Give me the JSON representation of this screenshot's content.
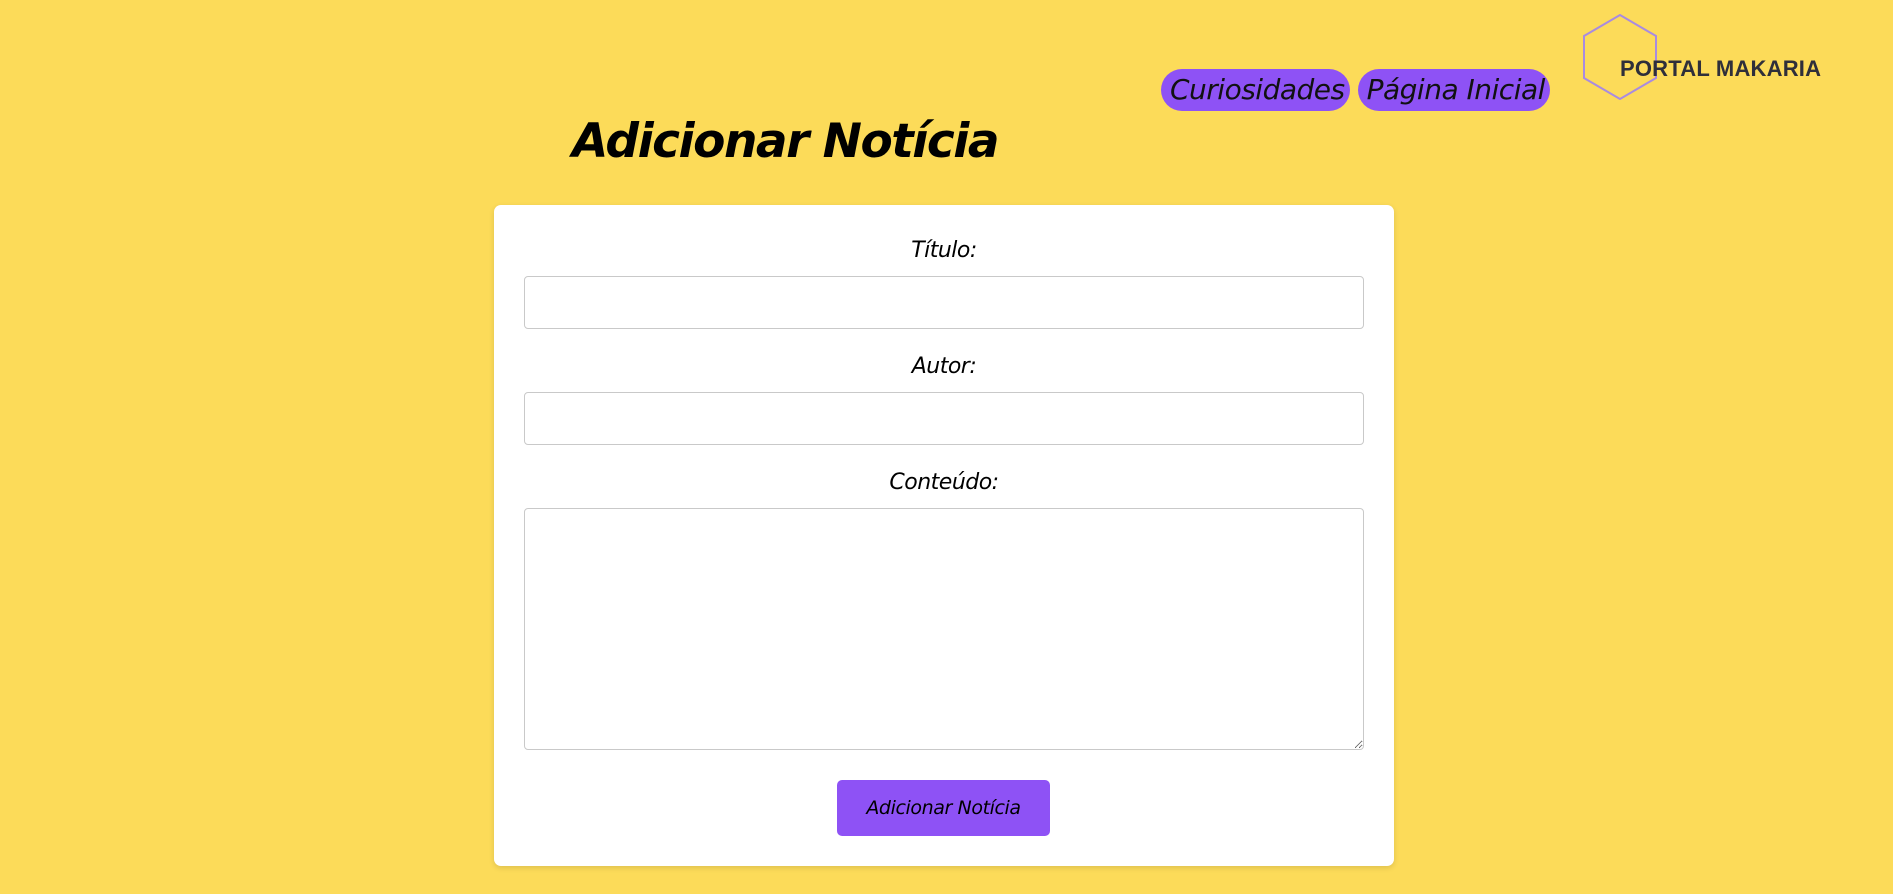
{
  "header": {
    "logo_text": "PORTAL MAKARIA",
    "nav": [
      {
        "label": "Curiosidades"
      },
      {
        "label": "Página Inicial"
      }
    ]
  },
  "main": {
    "title": "Adicionar Notícia",
    "form": {
      "titulo_label": "Título:",
      "titulo_value": "",
      "autor_label": "Autor:",
      "autor_value": "",
      "conteudo_label": "Conteúdo:",
      "conteudo_value": "",
      "submit_label": "Adicionar Notícia"
    }
  },
  "colors": {
    "background": "#fcdb59",
    "accent": "#8e52f5",
    "logo_outline": "#a98be0",
    "card": "#ffffff"
  }
}
